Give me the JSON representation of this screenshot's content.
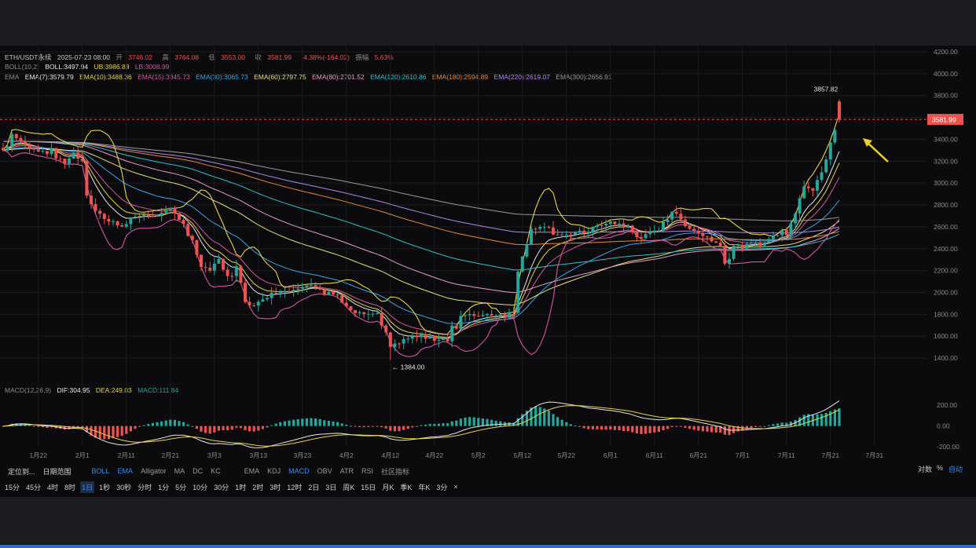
{
  "header": {
    "symbol": "ETH/USDT永续",
    "datetime": "2025-07-23 08:00",
    "open_label": "开",
    "open": "3746.02",
    "high_label": "高",
    "high": "3764.08",
    "low_label": "低",
    "low": "3553.00",
    "close_label": "收",
    "close": "3581.99",
    "change": "-4.38%(-164.02)",
    "amp_label": "振幅",
    "amp": "5.63%"
  },
  "boll": {
    "label": "BOLL(10,2)",
    "mid": "BOLL:3497.94",
    "ub": "UB:3986.88",
    "lb": "LB:3008.99"
  },
  "ema": {
    "label": "EMA",
    "items": [
      {
        "text": "EMA(7):3579.79",
        "color": "#e8e8e8"
      },
      {
        "text": "EMA(10):3488.36",
        "color": "#e8d44a"
      },
      {
        "text": "EMA(15):3345.73",
        "color": "#d657a0"
      },
      {
        "text": "EMA(30):3065.73",
        "color": "#3aa6e8"
      },
      {
        "text": "EMA(60):2797.75",
        "color": "#e3e07a"
      },
      {
        "text": "EMA(80):2701.52",
        "color": "#e89ec8"
      },
      {
        "text": "EMA(120):2610.86",
        "color": "#2fc2c8"
      },
      {
        "text": "EMA(180):2594.89",
        "color": "#e88a3a"
      },
      {
        "text": "EMA(220):2619.07",
        "color": "#b08ae8"
      },
      {
        "text": "EMA(300):2656.91",
        "color": "#9a9a9a"
      }
    ]
  },
  "macd": {
    "label": "MACD(12,26,9)",
    "dif": "DIF:304.95",
    "dea": "DEA:249.03",
    "macd": "MACD:111.84"
  },
  "colors": {
    "up": "#26a69a",
    "down": "#ef5350",
    "bg": "#0b0b0d",
    "grid": "#1c1c1f",
    "accent": "#3b8cf0"
  },
  "toolbar": {
    "draw": "定位到...",
    "range": "日期范围",
    "main_indicators": [
      "BOLL",
      "EMA",
      "Alligator",
      "MA",
      "DC",
      "KC"
    ],
    "sub_indicators": [
      "EMA",
      "KDJ",
      "MACD",
      "OBV",
      "ATR",
      "RSI"
    ],
    "community": "社区指标",
    "right": [
      "对数",
      "%",
      "自动"
    ]
  },
  "intervals": [
    "15分",
    "45分",
    "4时",
    "8时",
    "1日",
    "1秒",
    "30秒",
    "分时",
    "1分",
    "5分",
    "10分",
    "30分",
    "1时",
    "2时",
    "3时",
    "12时",
    "2日",
    "3日",
    "周K",
    "15日",
    "月K",
    "季K",
    "年K",
    "3分"
  ],
  "selected_interval": "1日",
  "chart_data": {
    "type": "candlestick",
    "dates": [
      "1月14",
      "1月15",
      "1月16",
      "1月17",
      "1月18",
      "1月19",
      "1月20",
      "1月21",
      "1月22",
      "1月23",
      "1月24",
      "1月25",
      "1月26",
      "1月27",
      "1月28",
      "1月29",
      "1月30",
      "1月31",
      "2月1",
      "2月2",
      "2月3",
      "2月4",
      "2月5",
      "2月6",
      "2月7",
      "2月8",
      "2月9",
      "2月10",
      "2月11",
      "2月12",
      "2月13",
      "2月14",
      "2月15",
      "2月16",
      "2月17",
      "2月18",
      "2月19",
      "2月20",
      "2月21",
      "2月22",
      "2月23",
      "2月24",
      "2月25",
      "2月26",
      "2月27",
      "2月28",
      "3月1",
      "3月2",
      "3月3",
      "3月4",
      "3月5",
      "3月6",
      "3月7",
      "3月8",
      "3月9",
      "3月10",
      "3月11",
      "3月12",
      "3月13",
      "3月14",
      "3月15",
      "3月16",
      "3月17",
      "3月18",
      "3月19",
      "3月20",
      "3月21",
      "3月22",
      "3月23",
      "3月24",
      "3月25",
      "3月26",
      "3月27",
      "3月28",
      "3月29",
      "3月30",
      "3月31",
      "4月1",
      "4月2",
      "4月3",
      "4月4",
      "4月5",
      "4月6",
      "4月7",
      "4月8",
      "4月9",
      "4月10",
      "4月11",
      "4月12",
      "4月13",
      "4月14",
      "4月15",
      "4月16",
      "4月17",
      "4月18",
      "4月19",
      "4月20",
      "4月21",
      "4月22",
      "4月23",
      "4月24",
      "4月25",
      "4月26",
      "4月27",
      "4月28",
      "4月29",
      "4月30",
      "5月1",
      "5月2",
      "5月3",
      "5月4",
      "5月5",
      "5月6",
      "5月7",
      "5月8",
      "5月9",
      "5月10",
      "5月11",
      "5月12",
      "5月13",
      "5月14",
      "5月15",
      "5月16",
      "5月17",
      "5月18",
      "5月19",
      "5月20",
      "5月21",
      "5月22",
      "5月23",
      "5月24",
      "5月25",
      "5月26",
      "5月27",
      "5月28",
      "5月29",
      "5月30",
      "5月31",
      "6月1",
      "6月2",
      "6月3",
      "6月4",
      "6月5",
      "6月6",
      "6月7",
      "6月8",
      "6月9",
      "6月10",
      "6月11",
      "6月12",
      "6月13",
      "6月14",
      "6月15",
      "6月16",
      "6月17",
      "6月18",
      "6月19",
      "6月20",
      "6月21",
      "6月22",
      "6月23",
      "6月24",
      "6月25",
      "6月26",
      "6月27",
      "6月28",
      "6月29",
      "6月30",
      "7月1",
      "7月2",
      "7月3",
      "7月4",
      "7月5",
      "7月6",
      "7月7",
      "7月8",
      "7月9",
      "7月10",
      "7月11",
      "7月12",
      "7月13",
      "7月14",
      "7月15",
      "7月16",
      "7月17",
      "7月18",
      "7月19",
      "7月20",
      "7月21",
      "7月22",
      "7月23"
    ],
    "close_anchors": [
      [
        0,
        3300
      ],
      [
        2,
        3450
      ],
      [
        5,
        3350
      ],
      [
        8,
        3300
      ],
      [
        11,
        3280
      ],
      [
        14,
        3180
      ],
      [
        16,
        3270
      ],
      [
        18,
        3200
      ],
      [
        19,
        2900
      ],
      [
        21,
        2750
      ],
      [
        24,
        2650
      ],
      [
        27,
        2620
      ],
      [
        30,
        2700
      ],
      [
        33,
        2700
      ],
      [
        36,
        2720
      ],
      [
        38,
        2740
      ],
      [
        41,
        2650
      ],
      [
        43,
        2450
      ],
      [
        45,
        2250
      ],
      [
        47,
        2200
      ],
      [
        49,
        2300
      ],
      [
        51,
        2150
      ],
      [
        53,
        2200
      ],
      [
        55,
        1900
      ],
      [
        58,
        1900
      ],
      [
        61,
        2000
      ],
      [
        64,
        2020
      ],
      [
        67,
        2050
      ],
      [
        70,
        2060
      ],
      [
        73,
        1990
      ],
      [
        76,
        2010
      ],
      [
        79,
        1820
      ],
      [
        82,
        1800
      ],
      [
        85,
        1780
      ],
      [
        87,
        1600
      ],
      [
        88,
        1480
      ],
      [
        90,
        1550
      ],
      [
        92,
        1580
      ],
      [
        95,
        1600
      ],
      [
        98,
        1570
      ],
      [
        101,
        1590
      ],
      [
        104,
        1780
      ],
      [
        107,
        1790
      ],
      [
        110,
        1800
      ],
      [
        113,
        1800
      ],
      [
        116,
        1820
      ],
      [
        117,
        2170
      ],
      [
        118,
        2350
      ],
      [
        120,
        2580
      ],
      [
        123,
        2620
      ],
      [
        126,
        2500
      ],
      [
        129,
        2540
      ],
      [
        132,
        2550
      ],
      [
        135,
        2600
      ],
      [
        138,
        2640
      ],
      [
        141,
        2620
      ],
      [
        144,
        2510
      ],
      [
        147,
        2520
      ],
      [
        150,
        2620
      ],
      [
        152,
        2770
      ],
      [
        154,
        2650
      ],
      [
        157,
        2570
      ],
      [
        160,
        2500
      ],
      [
        163,
        2450
      ],
      [
        164,
        2270
      ],
      [
        166,
        2420
      ],
      [
        169,
        2420
      ],
      [
        172,
        2450
      ],
      [
        175,
        2510
      ],
      [
        178,
        2580
      ],
      [
        180,
        2770
      ],
      [
        182,
        2950
      ],
      [
        184,
        2980
      ],
      [
        186,
        3150
      ],
      [
        188,
        3380
      ],
      [
        190,
        3600
      ],
      [
        192,
        3750
      ],
      [
        193,
        3582
      ]
    ],
    "labels": {
      "high_mark": "3857.82",
      "low_mark": "1384.00",
      "last_price": "3581.99"
    },
    "y_ticks": [
      "4200.00",
      "4000.00",
      "3800.00",
      "3600.00",
      "3400.00",
      "3200.00",
      "3000.00",
      "2800.00",
      "2600.00",
      "2400.00",
      "2200.00",
      "2000.00",
      "1800.00",
      "1600.00",
      "1400.00"
    ],
    "ylim": [
      1300,
      4200
    ],
    "x_ticks": [
      {
        "i": 8,
        "label": "1月22"
      },
      {
        "i": 18,
        "label": "2月1"
      },
      {
        "i": 28,
        "label": "2月11"
      },
      {
        "i": 38,
        "label": "2月21"
      },
      {
        "i": 48,
        "label": "3月3"
      },
      {
        "i": 58,
        "label": "3月13"
      },
      {
        "i": 68,
        "label": "3月23"
      },
      {
        "i": 78,
        "label": "4月2"
      },
      {
        "i": 88,
        "label": "4月12"
      },
      {
        "i": 98,
        "label": "4月22"
      },
      {
        "i": 108,
        "label": "5月2"
      },
      {
        "i": 118,
        "label": "5月12"
      },
      {
        "i": 128,
        "label": "5月22"
      },
      {
        "i": 138,
        "label": "6月1"
      },
      {
        "i": 148,
        "label": "6月11"
      },
      {
        "i": 158,
        "label": "6月21"
      },
      {
        "i": 168,
        "label": "7月1"
      },
      {
        "i": 178,
        "label": "7月11"
      },
      {
        "i": 188,
        "label": "7月21"
      },
      {
        "i": 198,
        "label": "7月31"
      }
    ],
    "macd_ticks": [
      "200.00",
      "0.00",
      "-200.00"
    ],
    "macd_ylim": [
      -230,
      300
    ]
  }
}
